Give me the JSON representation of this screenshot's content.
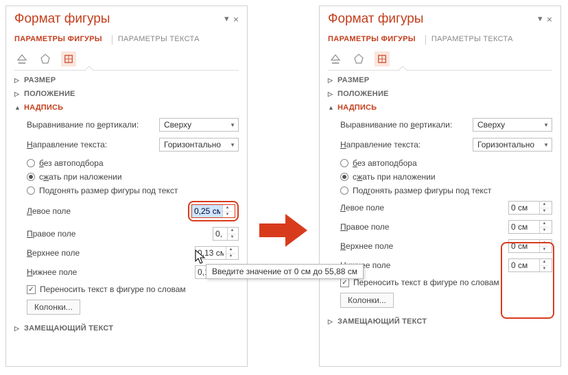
{
  "pane_title": "Формат фигуры",
  "tabs": {
    "shape": "ПАРАМЕТРЫ ФИГУРЫ",
    "text": "ПАРАМЕТРЫ ТЕКСТА"
  },
  "sections": {
    "size": "РАЗМЕР",
    "position": "ПОЛОЖЕНИЕ",
    "textbox": "НАДПИСЬ",
    "alttext": "ЗАМЕЩАЮЩИЙ ТЕКСТ"
  },
  "valign": {
    "label_pre": "Выравнивание по ",
    "label_u": "в",
    "label_post": "ертикали:",
    "value": "Сверху"
  },
  "dir": {
    "label_u": "Н",
    "label_post": "аправление текста:",
    "value": "Горизонтально"
  },
  "autofit": {
    "none_u": "б",
    "none_post": "ез автоподбора",
    "shrink_pre": "с",
    "shrink_u": "ж",
    "shrink_post": "ать при наложении",
    "resize_pre": "Под",
    "resize_u": "г",
    "resize_post": "онять размер фигуры под текст"
  },
  "margins": {
    "left_u": "Л",
    "left_post": "евое поле",
    "right_u": "П",
    "right_post": "равое поле",
    "top_u": "В",
    "top_post": "ерхнее поле",
    "bottom_u": "Н",
    "bottom_post": "ижнее поле"
  },
  "left_values": {
    "left": "0,25 см",
    "right": "0,",
    "top": "0,13 см",
    "bottom": "0,13 см"
  },
  "right_values": {
    "left": "0 см",
    "right": "0 см",
    "top": "0 см",
    "bottom": "0 см"
  },
  "wrap_label": "Переносить текст в фигуре по словам",
  "columns_label": "Колонки...",
  "tooltip": "Введите значение от 0 см до 55,88 см"
}
